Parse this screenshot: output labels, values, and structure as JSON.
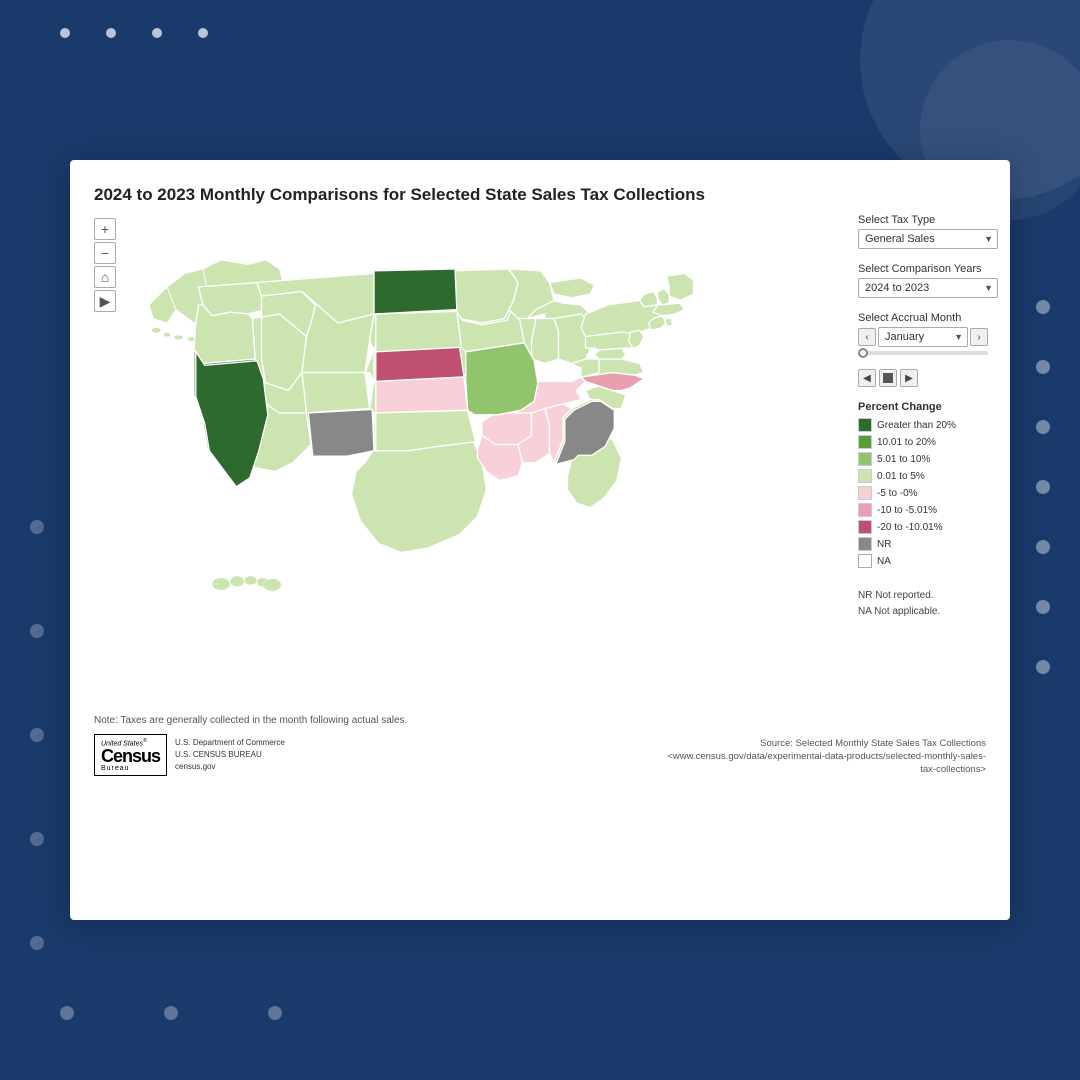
{
  "background": {
    "color": "#1a3a6b"
  },
  "card": {
    "title": "2024 to 2023 Monthly Comparisons for Selected State Sales Tax Collections"
  },
  "controls": {
    "tax_type_label": "Select Tax Type",
    "tax_type_value": "General Sales",
    "tax_type_arrow": "▼",
    "comparison_years_label": "Select Comparison Years",
    "comparison_years_value": "2024 to 2023",
    "accrual_month_label": "Select Accrual Month",
    "accrual_month_value": "January",
    "month_prev": "‹",
    "month_next": "›",
    "anim_prev": "◀",
    "anim_stop": "■",
    "anim_next": "▶"
  },
  "legend": {
    "title": "Percent Change",
    "items": [
      {
        "label": "Greater than 20%",
        "color": "#2d6a2d"
      },
      {
        "label": "10.01 to 20%",
        "color": "#5a9e3a"
      },
      {
        "label": "5.01 to 10%",
        "color": "#92c46e"
      },
      {
        "label": "0.01 to 5%",
        "color": "#cce4b0"
      },
      {
        "label": "-5 to -0%",
        "color": "#f7d0d8"
      },
      {
        "label": "-10 to -5.01%",
        "color": "#e8a0b0"
      },
      {
        "label": "-20 to -10.01%",
        "color": "#c05070"
      },
      {
        "label": "NR",
        "color": "#888888"
      },
      {
        "label": "NA",
        "color": "#ffffff"
      }
    ]
  },
  "legend_notes": {
    "line1": "NR Not reported.",
    "line2": "NA Not applicable."
  },
  "map_controls": {
    "zoom_in": "+",
    "zoom_out": "−",
    "home": "⌂",
    "arrow": "▶"
  },
  "footer": {
    "note": "Note: Taxes are generally collected in the month following actual sales.",
    "source_label": "Source: Selected Monthly State Sales Tax Collections",
    "source_url": "<www.census.gov/data/experimental-data-products/selected-monthly-sales-tax-collections>",
    "census_logo": {
      "united": "United States®",
      "census": "Census",
      "bureau": "Bureau",
      "dept": "U.S. Department of Commerce",
      "bureau_full": "U.S. CENSUS BUREAU",
      "site": "census.gov"
    }
  }
}
